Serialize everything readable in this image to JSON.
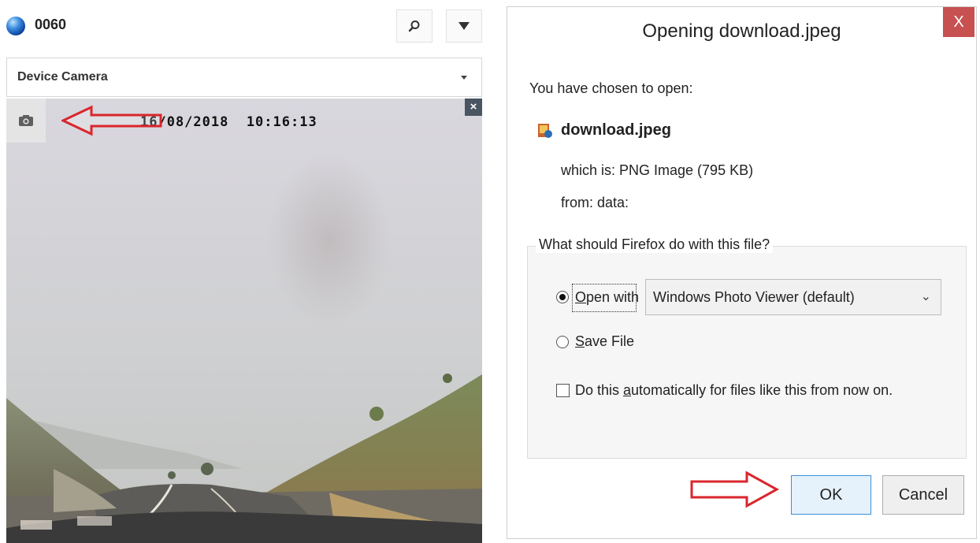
{
  "left_panel": {
    "device_id": "0060",
    "search_icon": "search-icon",
    "menu_icon": "triangle-down-icon",
    "source_select": {
      "value": "Device Camera"
    },
    "camera": {
      "timestamp": "16/08/2018  10:16:13",
      "snapshot_icon": "camera-icon",
      "close_label": "×"
    },
    "annotation_arrow_color": "#d9262c"
  },
  "dialog": {
    "title": "Opening download.jpeg",
    "close_label": "X",
    "intro": "You have chosen to open:",
    "file_name": "download.jpeg",
    "which_is": "which is:  PNG Image (795 KB)",
    "from": "from:  data:",
    "question": "What should Firefox do with this file?",
    "open_with_label": "Open with",
    "open_with_app": "Windows Photo Viewer (default)",
    "save_file_label": "Save File",
    "auto_label_pre": "Do this ",
    "auto_label_accel": "a",
    "auto_label_post": "utomatically for files like this from now on.",
    "ok_label": "OK",
    "cancel_label": "Cancel",
    "open_with_selected": true,
    "save_file_selected": false,
    "auto_checked": false
  },
  "colors": {
    "arrow_red": "#d9262c",
    "close_red": "#c75050",
    "default_button_border": "#3c8fd8"
  }
}
